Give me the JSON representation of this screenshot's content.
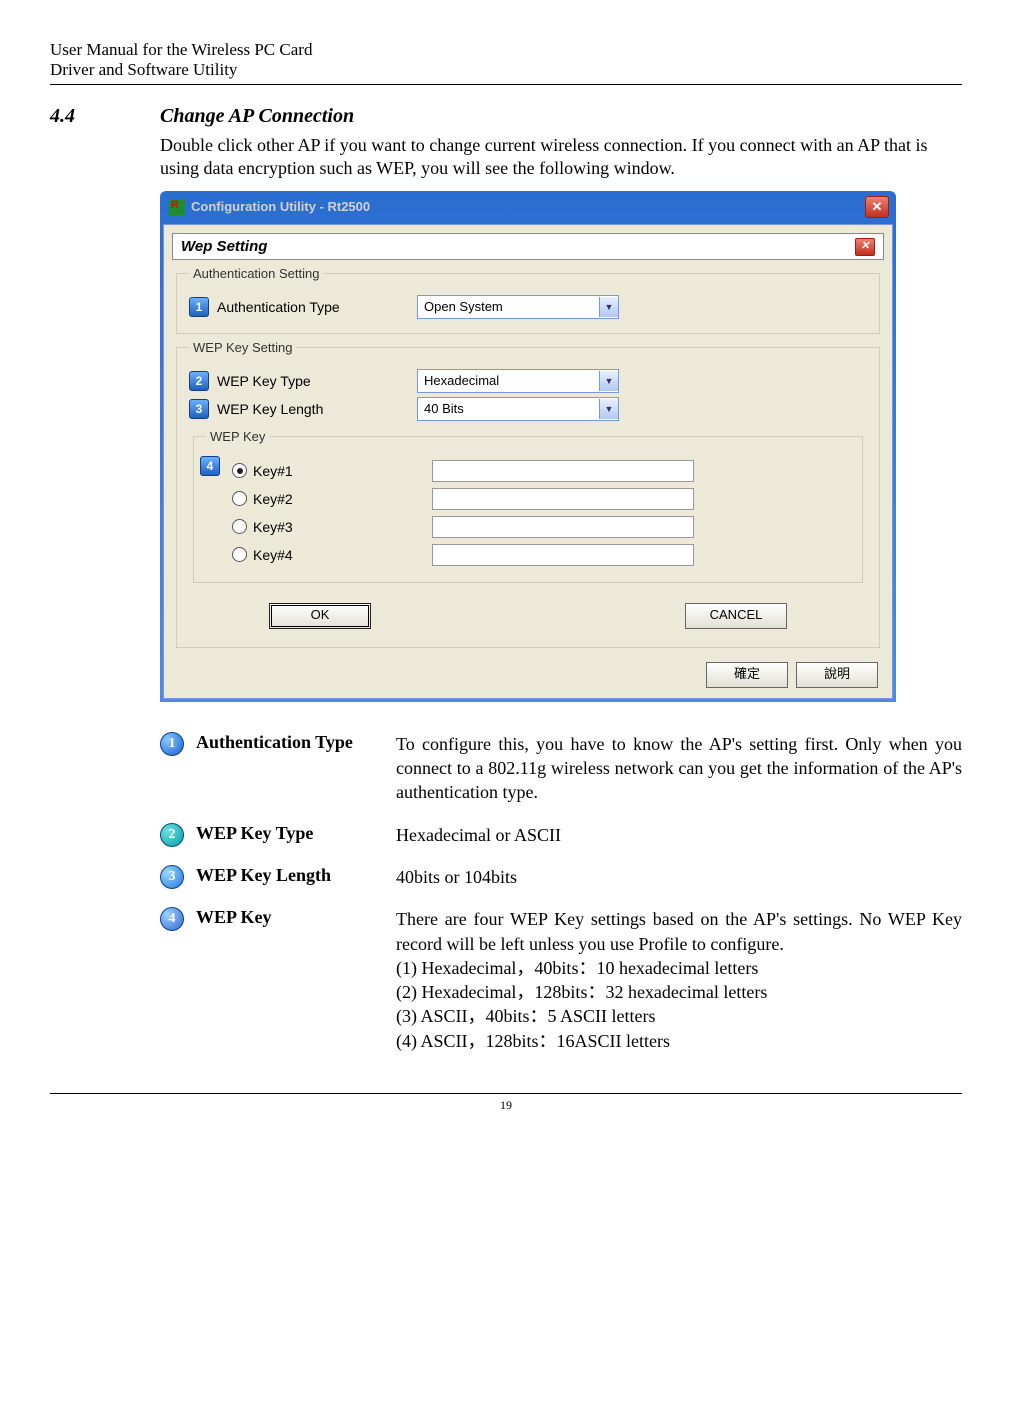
{
  "header": {
    "line1": "User Manual for the Wireless PC Card",
    "line2": "Driver and Software Utility"
  },
  "section": {
    "num": "4.4",
    "title": "Change AP Connection",
    "intro": "Double click other AP if you want to change current wireless connection. If you connect with an AP that is using data encryption such as WEP, you will see the following window."
  },
  "dialog": {
    "window_title": "Configuration Utility - Rt2500",
    "panel_title": "Wep Setting",
    "group_auth": "Authentication Setting",
    "auth_type_label": "Authentication Type",
    "auth_type_value": "Open System",
    "group_wepkey": "WEP Key Setting",
    "wep_key_type_label": "WEP Key Type",
    "wep_key_type_value": "Hexadecimal",
    "wep_key_len_label": "WEP Key Length",
    "wep_key_len_value": "40 Bits",
    "group_keys": "WEP Key",
    "keys": [
      "Key#1",
      "Key#2",
      "Key#3",
      "Key#4"
    ],
    "ok": "OK",
    "cancel": "CANCEL",
    "confirm": "確定",
    "help": "說明"
  },
  "desc": {
    "items": [
      {
        "n": "1",
        "label": "Authentication Type",
        "text": "To configure this, you have to know the AP's setting first. Only when you connect to a 802.11g wireless network can you get the information of the AP's authentication type."
      },
      {
        "n": "2",
        "label": "WEP Key Type",
        "text": "Hexadecimal or ASCII"
      },
      {
        "n": "3",
        "label": "WEP Key Length",
        "text": "40bits or 104bits"
      },
      {
        "n": "4",
        "label": "WEP Key",
        "text": "There are four WEP Key settings based on the AP's settings. No WEP Key record will be left unless you use Profile to configure.",
        "sub": [
          "(1) Hexadecimal，40bits：10 hexadecimal letters",
          "(2) Hexadecimal，128bits：32 hexadecimal letters",
          "(3) ASCII，40bits：5 ASCII letters",
          "(4) ASCII，128bits：16ASCII letters"
        ]
      }
    ]
  },
  "page_number": "19"
}
